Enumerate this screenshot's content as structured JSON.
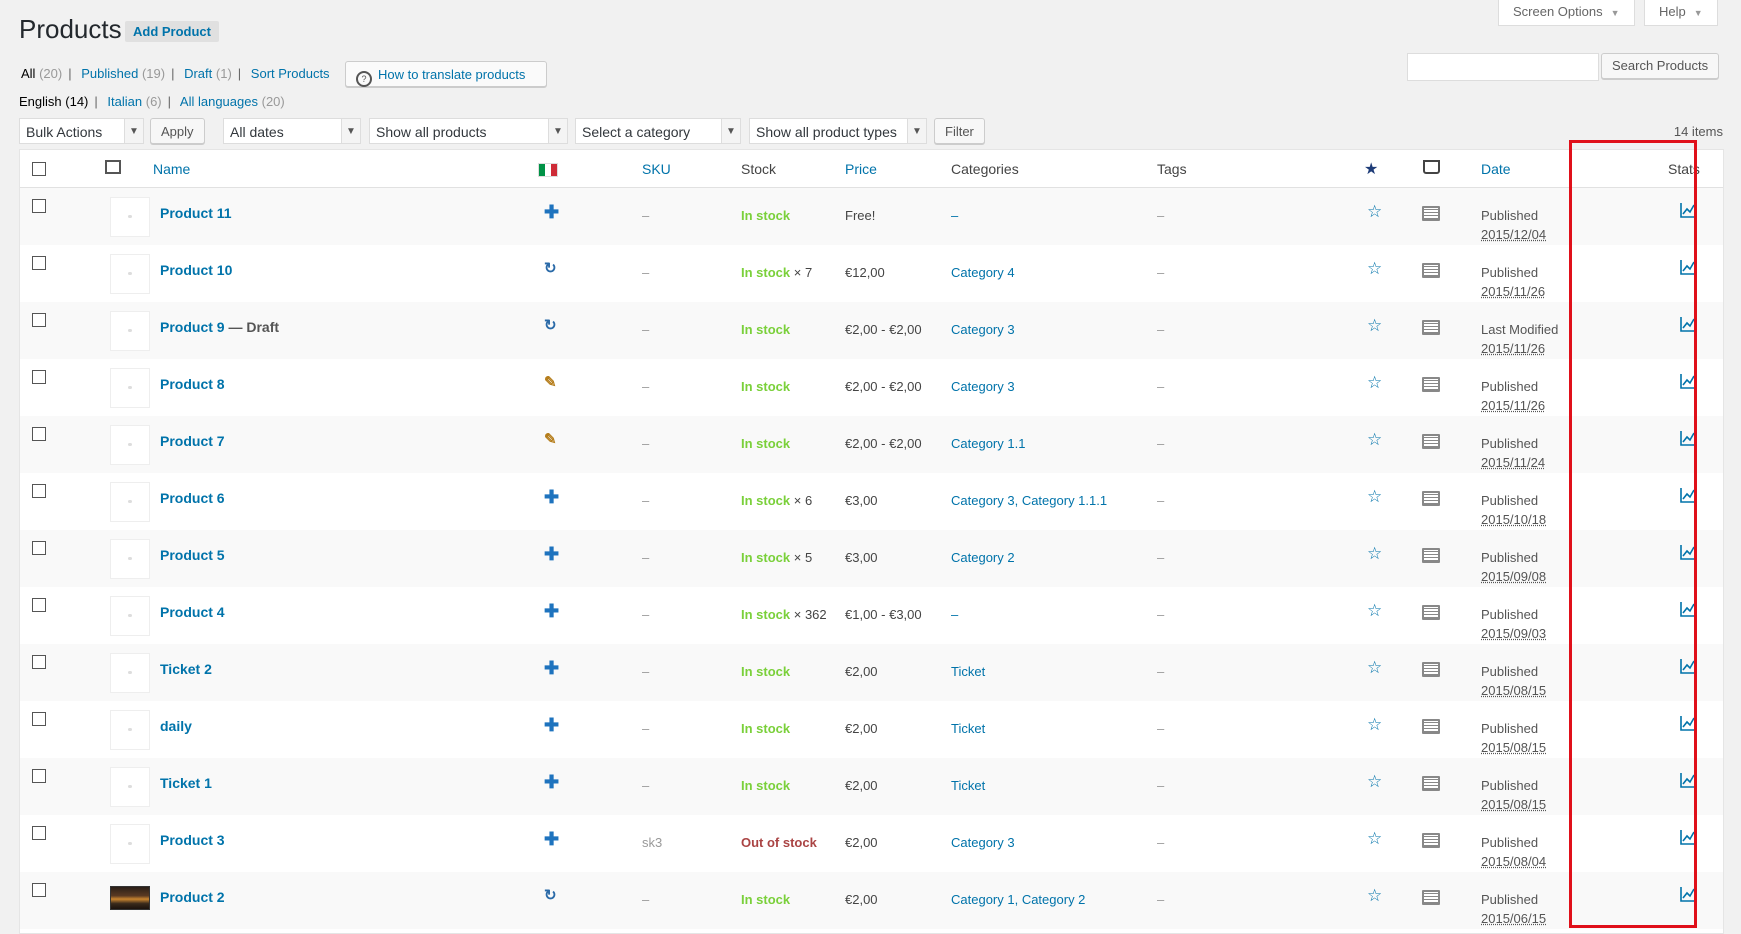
{
  "header": {
    "title": "Products",
    "add_label": "Add Product",
    "screen_options": "Screen Options",
    "help": "Help"
  },
  "search": {
    "button": "Search Products",
    "placeholder": ""
  },
  "views": [
    {
      "label": "All",
      "count": "(20)"
    },
    {
      "label": "Published",
      "count": "(19)"
    },
    {
      "label": "Draft",
      "count": "(1)"
    },
    {
      "label": "Sort Products",
      "count": ""
    }
  ],
  "howto_label": "How to translate products",
  "languages": [
    {
      "label": "English",
      "count": "(14)"
    },
    {
      "label": "Italian",
      "count": "(6)"
    },
    {
      "label": "All languages",
      "count": "(20)"
    }
  ],
  "filters": {
    "bulk_actions": "Bulk Actions",
    "apply": "Apply",
    "dates": "All dates",
    "products": "Show all products",
    "category": "Select a category",
    "types": "Show all product types",
    "filter": "Filter",
    "items_count": "14 items"
  },
  "columns": {
    "name": "Name",
    "sku": "SKU",
    "stock": "Stock",
    "price": "Price",
    "categories": "Categories",
    "tags": "Tags",
    "date": "Date",
    "stats": "Stats"
  },
  "rows": [
    {
      "name": "Product 11",
      "suffix": "",
      "lang_icon": "plus-icon",
      "sku": "–",
      "stock": "In stock",
      "stock_extra": "",
      "price": "Free!",
      "categories": "–",
      "tags": "–",
      "status": "Published",
      "date": "2015/12/04",
      "thumb": "placeholder"
    },
    {
      "name": "Product 10",
      "suffix": "",
      "lang_icon": "sync-icon",
      "sku": "–",
      "stock": "In stock",
      "stock_extra": " × 7",
      "price": "€12,00",
      "categories": "Category 4",
      "tags": "–",
      "status": "Published",
      "date": "2015/11/26",
      "thumb": "placeholder"
    },
    {
      "name": "Product 9",
      "suffix": " — Draft",
      "lang_icon": "sync-icon",
      "sku": "–",
      "stock": "In stock",
      "stock_extra": "",
      "price": "€2,00 - €2,00",
      "categories": "Category 3",
      "tags": "–",
      "status": "Last Modified",
      "date": "2015/11/26",
      "thumb": "placeholder"
    },
    {
      "name": "Product 8",
      "suffix": "",
      "lang_icon": "pencil-icon",
      "sku": "–",
      "stock": "In stock",
      "stock_extra": "",
      "price": "€2,00 - €2,00",
      "categories": "Category 3",
      "tags": "–",
      "status": "Published",
      "date": "2015/11/26",
      "thumb": "placeholder"
    },
    {
      "name": "Product 7",
      "suffix": "",
      "lang_icon": "pencil-icon",
      "sku": "–",
      "stock": "In stock",
      "stock_extra": "",
      "price": "€2,00 - €2,00",
      "categories": "Category 1.1",
      "tags": "–",
      "status": "Published",
      "date": "2015/11/24",
      "thumb": "placeholder"
    },
    {
      "name": "Product 6",
      "suffix": "",
      "lang_icon": "plus-icon",
      "sku": "–",
      "stock": "In stock",
      "stock_extra": " × 6",
      "price": "€3,00",
      "categories": "Category 3, Category 1.1.1",
      "tags": "–",
      "status": "Published",
      "date": "2015/10/18",
      "thumb": "placeholder"
    },
    {
      "name": "Product 5",
      "suffix": "",
      "lang_icon": "plus-icon",
      "sku": "–",
      "stock": "In stock",
      "stock_extra": " × 5",
      "price": "€3,00",
      "categories": "Category 2",
      "tags": "–",
      "status": "Published",
      "date": "2015/09/08",
      "thumb": "placeholder"
    },
    {
      "name": "Product 4",
      "suffix": "",
      "lang_icon": "plus-icon",
      "sku": "–",
      "stock": "In stock",
      "stock_extra": " × 362",
      "price": "€1,00 - €3,00",
      "categories": "–",
      "tags": "–",
      "status": "Published",
      "date": "2015/09/03",
      "thumb": "placeholder"
    },
    {
      "name": "Ticket 2",
      "suffix": "",
      "lang_icon": "plus-icon",
      "sku": "–",
      "stock": "In stock",
      "stock_extra": "",
      "price": "€2,00",
      "categories": "Ticket",
      "tags": "–",
      "status": "Published",
      "date": "2015/08/15",
      "thumb": "placeholder"
    },
    {
      "name": "daily",
      "suffix": "",
      "lang_icon": "plus-icon",
      "sku": "–",
      "stock": "In stock",
      "stock_extra": "",
      "price": "€2,00",
      "categories": "Ticket",
      "tags": "–",
      "status": "Published",
      "date": "2015/08/15",
      "thumb": "placeholder"
    },
    {
      "name": "Ticket 1",
      "suffix": "",
      "lang_icon": "plus-icon",
      "sku": "–",
      "stock": "In stock",
      "stock_extra": "",
      "price": "€2,00",
      "categories": "Ticket",
      "tags": "–",
      "status": "Published",
      "date": "2015/08/15",
      "thumb": "placeholder"
    },
    {
      "name": "Product 3",
      "suffix": "",
      "lang_icon": "plus-icon",
      "sku": "sk3",
      "stock": "Out of stock",
      "stock_extra": "",
      "price": "€2,00",
      "categories": "Category 3",
      "tags": "–",
      "status": "Published",
      "date": "2015/08/04",
      "thumb": "placeholder"
    },
    {
      "name": "Product 2",
      "suffix": "",
      "lang_icon": "sync-icon",
      "sku": "–",
      "stock": "In stock",
      "stock_extra": "",
      "price": "€2,00",
      "categories": "Category 1, Category 2",
      "tags": "–",
      "status": "Published",
      "date": "2015/06/15",
      "thumb": "photo"
    }
  ],
  "colors": {
    "link": "#0073aa",
    "in_stock": "#7ad03a",
    "out_of_stock": "#a44444",
    "highlight": "#e0101a"
  }
}
